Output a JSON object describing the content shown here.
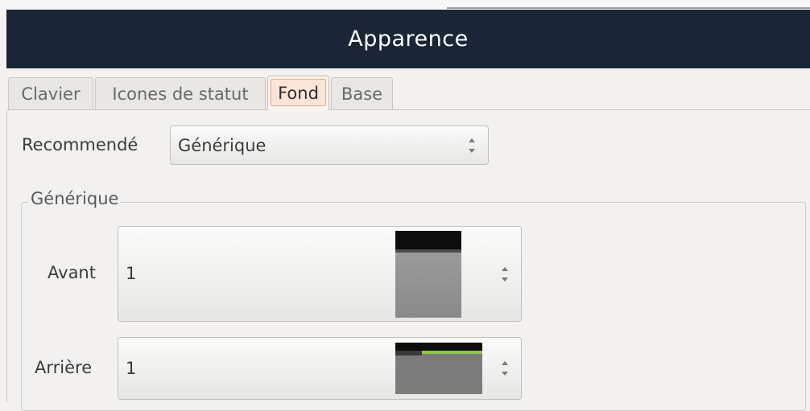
{
  "window": {
    "title": "Apparence"
  },
  "tabs": [
    {
      "label": "Clavier"
    },
    {
      "label": "Icones de statut"
    },
    {
      "label": "Fond"
    },
    {
      "label": "Base"
    }
  ],
  "active_tab": "Fond",
  "recommended": {
    "label": "Recommendé",
    "value": "Générique"
  },
  "group": {
    "title": "Générique",
    "front": {
      "label": "Avant",
      "value": "1"
    },
    "back": {
      "label": "Arrière",
      "value": "1"
    }
  },
  "colors": {
    "titlebar": "#1a2536",
    "active_tab_highlight": "#fde4d8",
    "thumbnail_accent": "#8fc640"
  }
}
